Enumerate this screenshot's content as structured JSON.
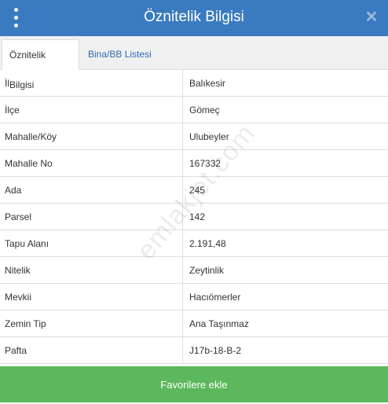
{
  "header": {
    "title": "Öznitelik Bilgisi",
    "menu_icon": "vertical-ellipsis-icon",
    "close_icon": "close-icon",
    "close_symbol": "✕",
    "color": "#3a7ac0"
  },
  "tabs": [
    {
      "label": "Öznitelik Bilgisi",
      "active": true
    },
    {
      "label": "Bina/BB Listesi",
      "active": false
    }
  ],
  "attributes": [
    {
      "key": "İl",
      "value": "Balıkesir"
    },
    {
      "key": "İlçe",
      "value": "Gömeç"
    },
    {
      "key": "Mahalle/Köy",
      "value": "Ulubeyler"
    },
    {
      "key": "Mahalle No",
      "value": "167332"
    },
    {
      "key": "Ada",
      "value": "245"
    },
    {
      "key": "Parsel",
      "value": "142"
    },
    {
      "key": "Tapu Alanı",
      "value": "2.191,48"
    },
    {
      "key": "Nitelik",
      "value": "Zeytinlik"
    },
    {
      "key": "Mevkii",
      "value": "Hacıömerler"
    },
    {
      "key": "Zemin Tip",
      "value": "Ana Taşınmaz"
    },
    {
      "key": "Pafta",
      "value": "J17b-18-B-2"
    }
  ],
  "watermark": "emlakjet.com",
  "footer": {
    "button_label": "Favorilere ekle",
    "color": "#5cb85c"
  }
}
